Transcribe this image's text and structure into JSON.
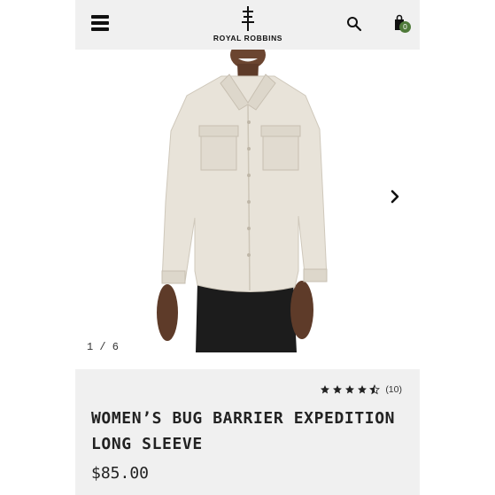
{
  "header": {
    "brand": "ROYAL ROBBINS",
    "cart_count": "0"
  },
  "gallery": {
    "counter": "1 / 6"
  },
  "product": {
    "title_line1": "WOMEN’S BUG BARRIER EXPEDITION",
    "title_line2": "LONG SLEEVE",
    "price": "$85.00",
    "rating": 4.5,
    "review_count": "(10)"
  },
  "colors": {
    "header_bg": "#f0f0f0",
    "cart_badge": "#4f7a3a",
    "text": "#222222"
  },
  "icons": [
    "hamburger-menu-icon",
    "brand-logo-icon",
    "search-icon",
    "shopping-bag-icon",
    "chevron-right-icon",
    "star-icon"
  ]
}
